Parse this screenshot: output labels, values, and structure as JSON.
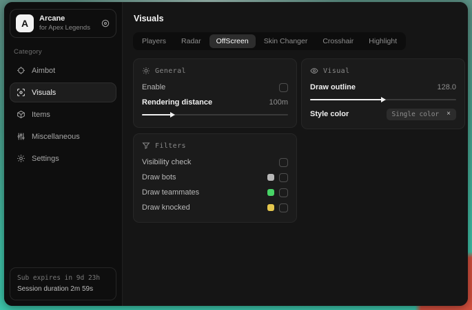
{
  "sidebar": {
    "brand": {
      "logo_letter": "A",
      "name": "Arcane",
      "subtitle": "for Apex Legends"
    },
    "category_label": "Category",
    "items": [
      {
        "label": "Aimbot",
        "icon": "crosshair-icon"
      },
      {
        "label": "Visuals",
        "icon": "scan-eye-icon"
      },
      {
        "label": "Items",
        "icon": "box-icon"
      },
      {
        "label": "Miscellaneous",
        "icon": "sliders-icon"
      },
      {
        "label": "Settings",
        "icon": "gear-icon"
      }
    ],
    "selected_item": "Visuals",
    "subscription": {
      "line1": "Sub expires in 9d 23h",
      "line2": "Session duration 2m 59s"
    }
  },
  "header": {
    "title": "Visuals"
  },
  "tabs": [
    {
      "label": "Players"
    },
    {
      "label": "Radar"
    },
    {
      "label": "OffScreen",
      "selected": true
    },
    {
      "label": "Skin Changer"
    },
    {
      "label": "Crosshair"
    },
    {
      "label": "Highlight"
    }
  ],
  "panels": {
    "general": {
      "title": "General",
      "icon": "sun-icon",
      "enable": {
        "label": "Enable",
        "checked": false
      },
      "rendering_distance": {
        "label": "Rendering distance",
        "value": "100m",
        "percent": 20
      }
    },
    "filters": {
      "title": "Filters",
      "icon": "funnel-icon",
      "rows": [
        {
          "label": "Visibility check",
          "checked": false
        },
        {
          "label": "Draw bots",
          "swatch": "#b8b8b8",
          "checked": false
        },
        {
          "label": "Draw teammates",
          "swatch": "#47d366",
          "checked": false
        },
        {
          "label": "Draw knocked",
          "swatch": "#e4c64d",
          "checked": false
        }
      ]
    },
    "visual": {
      "title": "Visual",
      "icon": "eye-icon",
      "draw_outline": {
        "label": "Draw outline",
        "value": "128.0",
        "percent": 49
      },
      "style_color": {
        "label": "Style color",
        "tag": "Single color",
        "remove_icon": "×"
      }
    }
  },
  "colors": {
    "desktop_teal": "#3fc2a8",
    "desktop_red": "#d5503e",
    "swatch_bots": "#b8b8b8",
    "swatch_teammates": "#47d366",
    "swatch_knocked": "#e4c64d"
  }
}
